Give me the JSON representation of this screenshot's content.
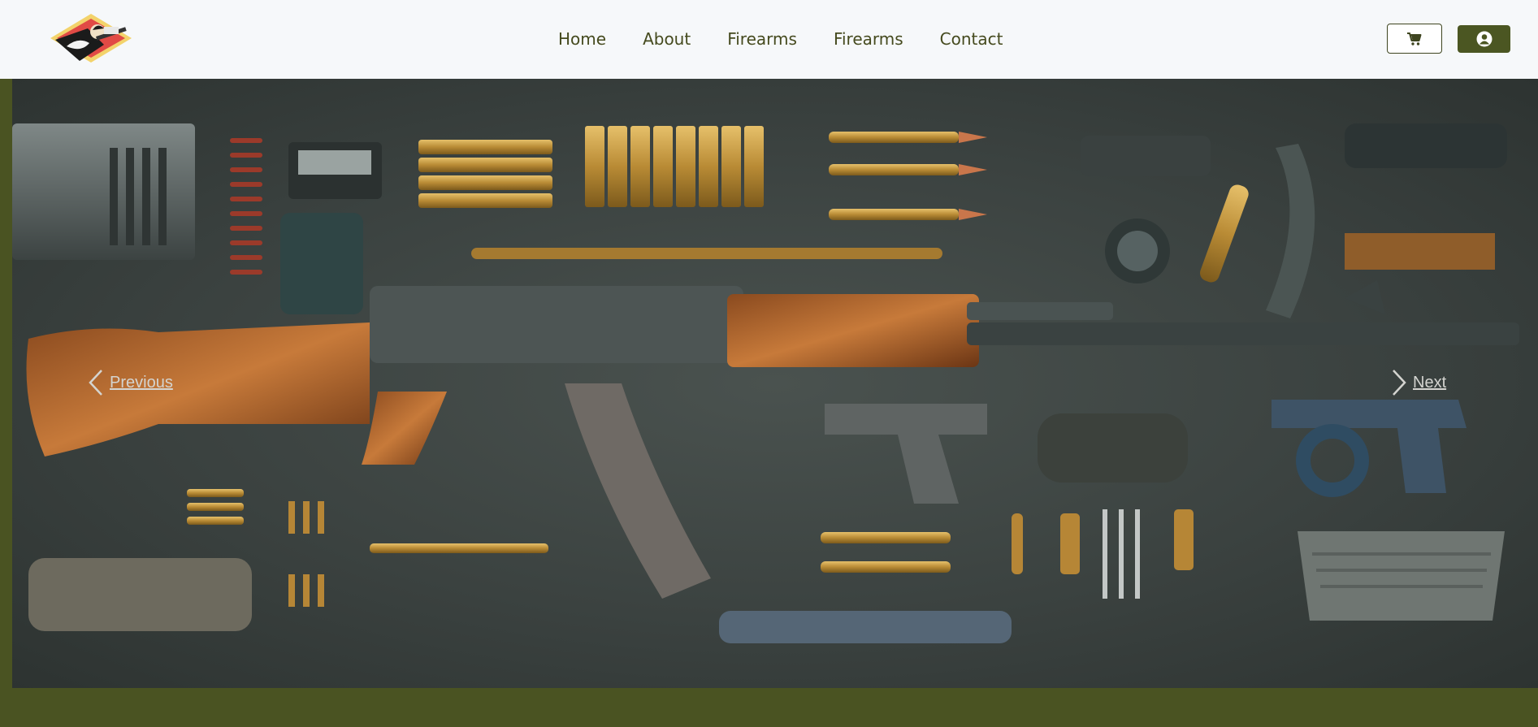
{
  "navbar": {
    "logo_icon": "soldier-rifle-logo",
    "links": [
      "Home",
      "About",
      "Firearms",
      "Firearms",
      "Contact"
    ],
    "cart_icon": "cart-icon",
    "user_icon": "user-circle-icon"
  },
  "carousel": {
    "image_icon": "firearms-flatlay-image",
    "previous_label": "Previous",
    "next_label": "Next"
  },
  "colors": {
    "accent": "#4b5622",
    "page_background": "#4a5322",
    "navbar_background": "#f6f8fa",
    "nav_text": "#454a1e"
  }
}
